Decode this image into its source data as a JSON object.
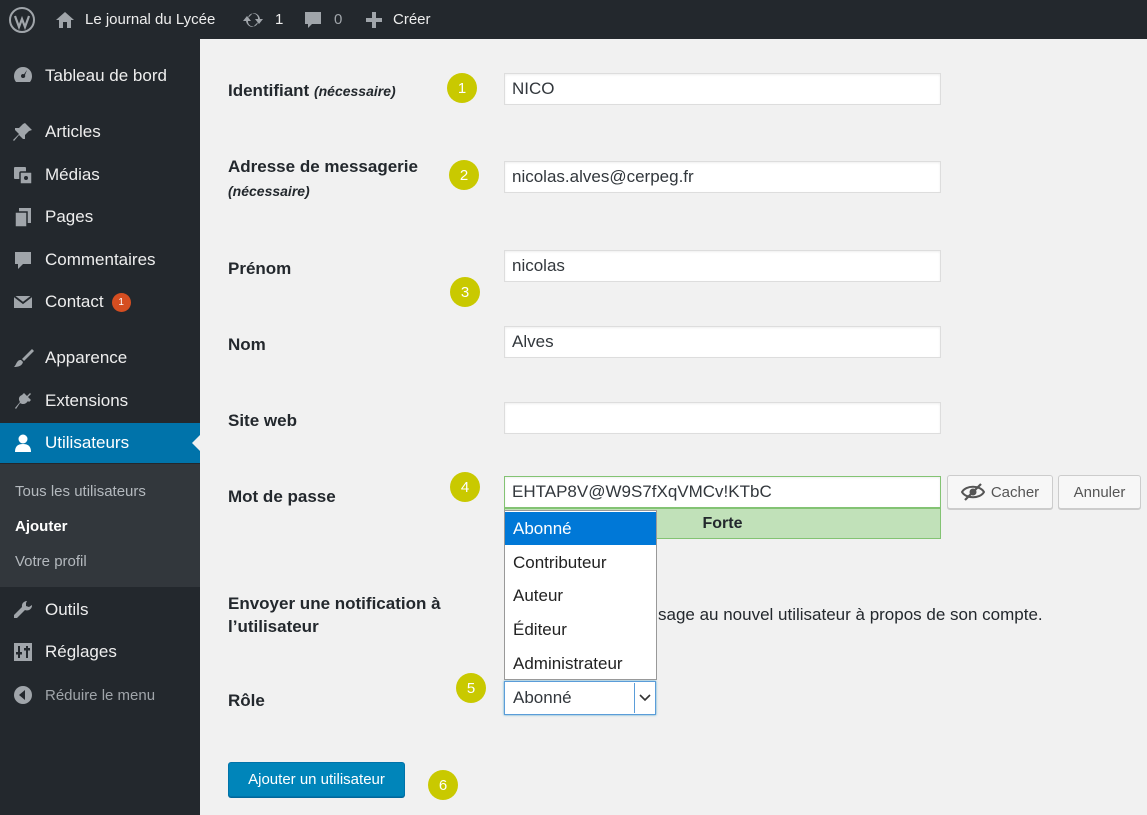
{
  "adminbar": {
    "site_name": "Le journal du Lycée",
    "updates_count": "1",
    "comments_count": "0",
    "new_label": "Créer"
  },
  "sidebar": {
    "items": [
      {
        "label": "Tableau de bord",
        "icon": "dashboard-icon"
      },
      {
        "label": "Articles",
        "icon": "pushpin-icon"
      },
      {
        "label": "Médias",
        "icon": "media-icon"
      },
      {
        "label": "Pages",
        "icon": "pages-icon"
      },
      {
        "label": "Commentaires",
        "icon": "comment-icon"
      },
      {
        "label": "Contact",
        "icon": "mail-icon",
        "badge": "1"
      },
      {
        "label": "Apparence",
        "icon": "brush-icon"
      },
      {
        "label": "Extensions",
        "icon": "plugin-icon"
      },
      {
        "label": "Utilisateurs",
        "icon": "user-icon",
        "current": true
      },
      {
        "label": "Outils",
        "icon": "wrench-icon"
      },
      {
        "label": "Réglages",
        "icon": "settings-icon"
      }
    ],
    "submenu": [
      "Tous les utilisateurs",
      "Ajouter",
      "Votre profil"
    ],
    "collapse_label": "Réduire le menu"
  },
  "form": {
    "username_label": "Identifiant",
    "username_required": "(nécessaire)",
    "username_value": "NICO",
    "email_label": "Adresse de messagerie",
    "email_required": "(nécessaire)",
    "email_value": "nicolas.alves@cerpeg.fr",
    "firstname_label": "Prénom",
    "firstname_value": "nicolas",
    "lastname_label": "Nom",
    "lastname_value": "Alves",
    "website_label": "Site web",
    "website_value": "",
    "password_label": "Mot de passe",
    "password_value": "EHTAP8V@W9S7fXqVMCv!KTbC",
    "hide_label": "Cacher",
    "cancel_label": "Annuler",
    "strength_label": "Forte",
    "notify_label_line1": "Envoyer une notification à",
    "notify_label_line2": "l’utilisateur",
    "notify_text": "sage au nouvel utilisateur à propos de son compte.",
    "role_label": "Rôle",
    "role_value": "Abonné",
    "role_options": [
      "Abonné",
      "Contributeur",
      "Auteur",
      "Éditeur",
      "Administrateur"
    ],
    "submit_label": "Ajouter un utilisateur"
  },
  "steps": [
    "1",
    "2",
    "3",
    "4",
    "5",
    "6"
  ],
  "colors": {
    "adminbar_bg": "#23282d",
    "accent": "#0073aa",
    "primary_button": "#0085ba",
    "step_marker": "#c9c900",
    "strength_bg": "#c1e1b9",
    "dropdown_selected": "#0078d7",
    "badge": "#d54e21"
  }
}
